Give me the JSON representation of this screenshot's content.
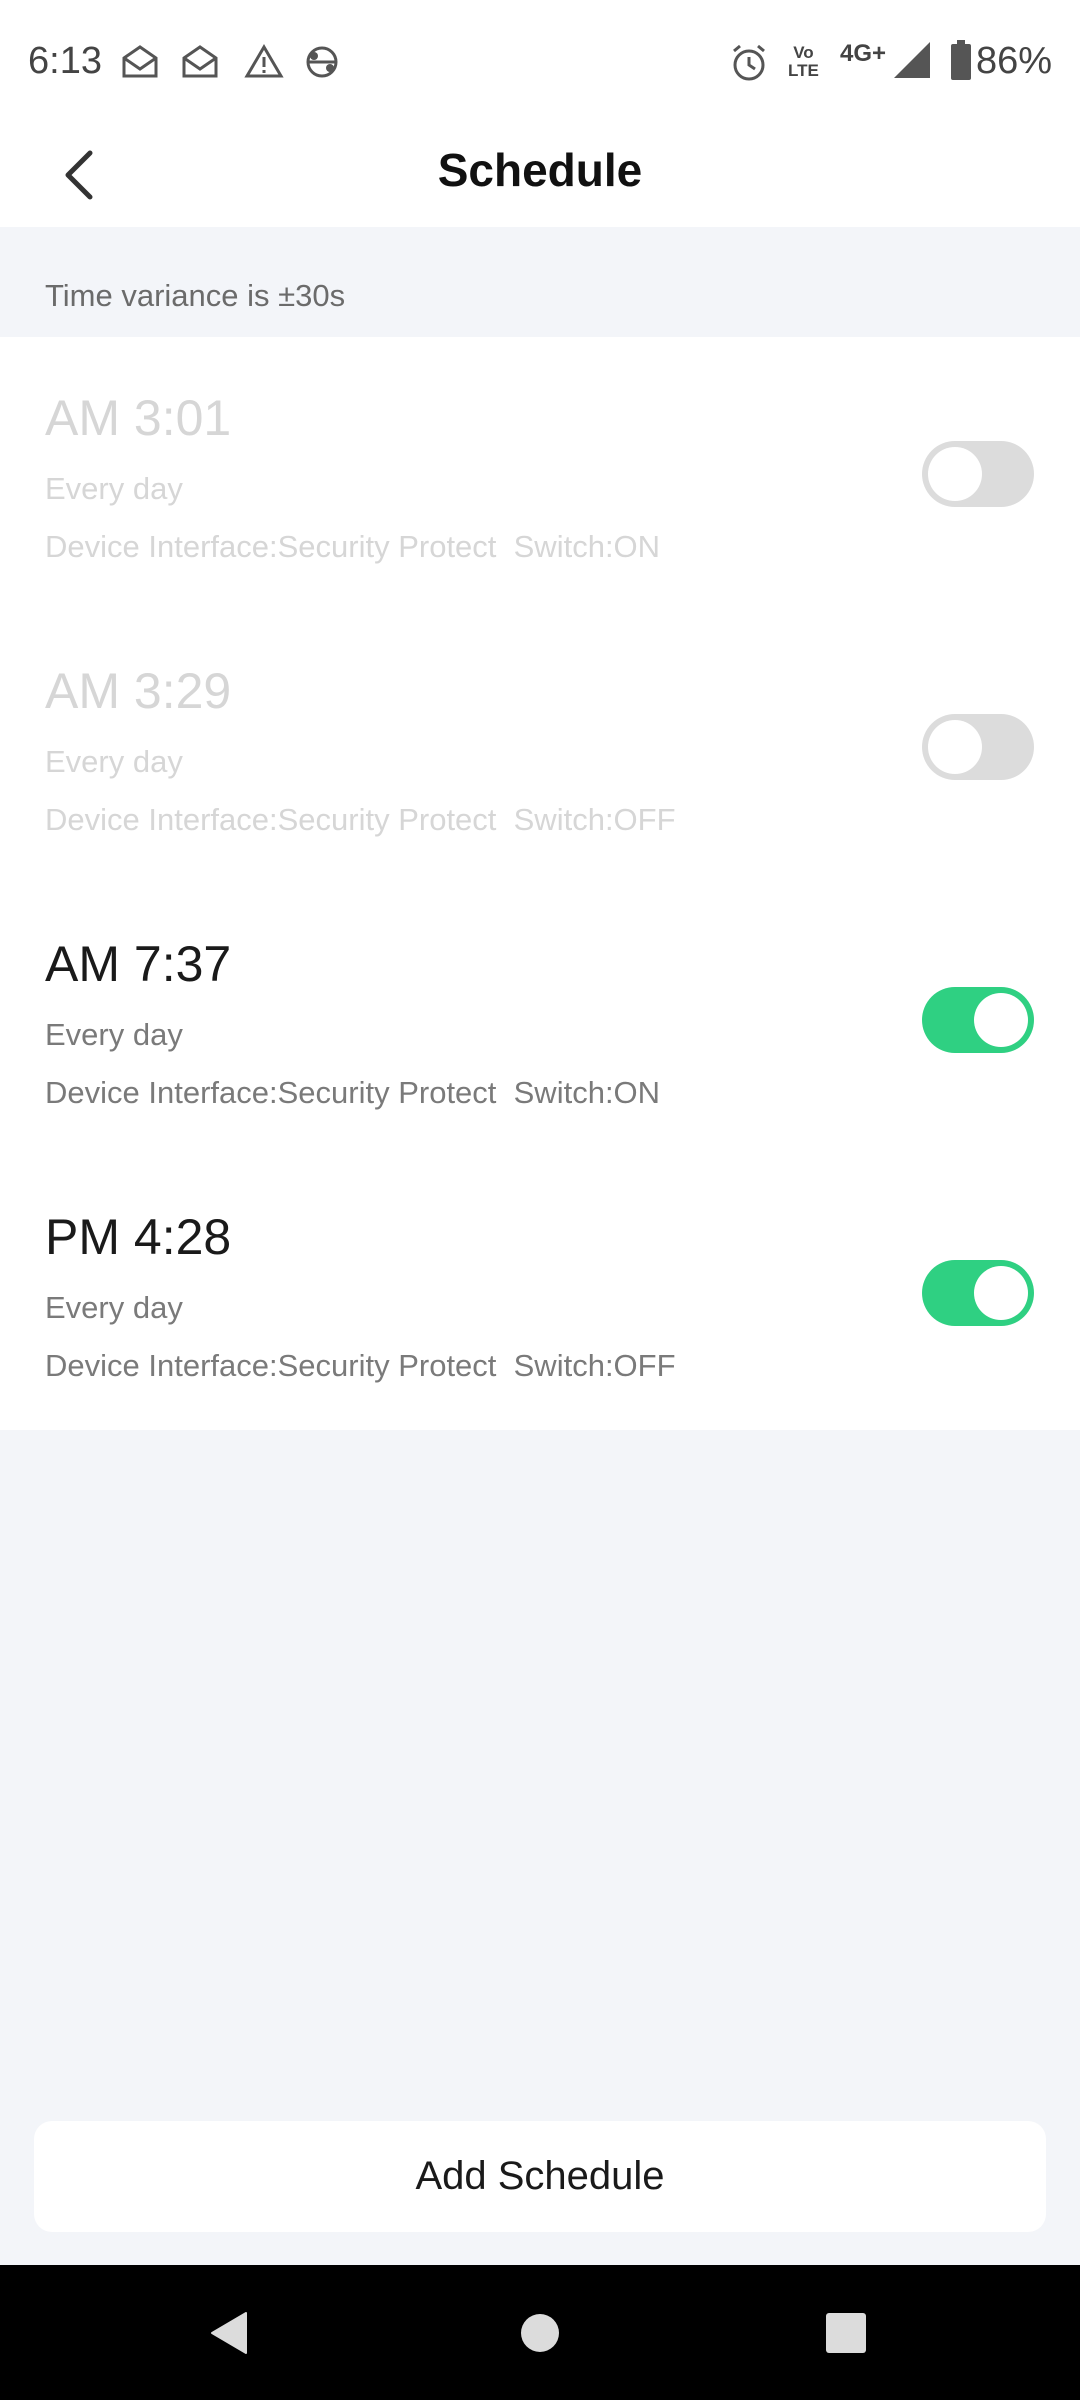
{
  "status_bar": {
    "time": "6:13",
    "network": "4G+",
    "volte_top": "Vo",
    "volte_bottom": "LTE",
    "battery": "86%",
    "notification_icons": [
      "mail-open-icon",
      "mail-open-icon",
      "warning-icon",
      "sync-icon"
    ],
    "system_icons": [
      "alarm-icon",
      "volte-icon",
      "signal-icon",
      "battery-icon"
    ]
  },
  "header": {
    "title": "Schedule",
    "back_icon": "chevron-left-icon"
  },
  "notice": {
    "text": "Time variance is ±30s"
  },
  "schedules": [
    {
      "time": "AM 3:01",
      "repeat": "Every day",
      "detail": "Device Interface:Security Protect  Switch:ON",
      "enabled": false
    },
    {
      "time": "AM 3:29",
      "repeat": "Every day",
      "detail": "Device Interface:Security Protect  Switch:OFF",
      "enabled": false
    },
    {
      "time": "AM 7:37",
      "repeat": "Every day",
      "detail": "Device Interface:Security Protect  Switch:ON",
      "enabled": true
    },
    {
      "time": "PM 4:28",
      "repeat": "Every day",
      "detail": "Device Interface:Security Protect  Switch:OFF",
      "enabled": true
    }
  ],
  "add_button": {
    "label": "Add Schedule"
  },
  "nav_bar": {
    "icons": [
      "back-triangle-icon",
      "home-circle-icon",
      "recents-square-icon"
    ]
  },
  "colors": {
    "toggle_on": "#2fd082",
    "toggle_off": "#dcdcdc",
    "background": "#f3f5f9"
  }
}
